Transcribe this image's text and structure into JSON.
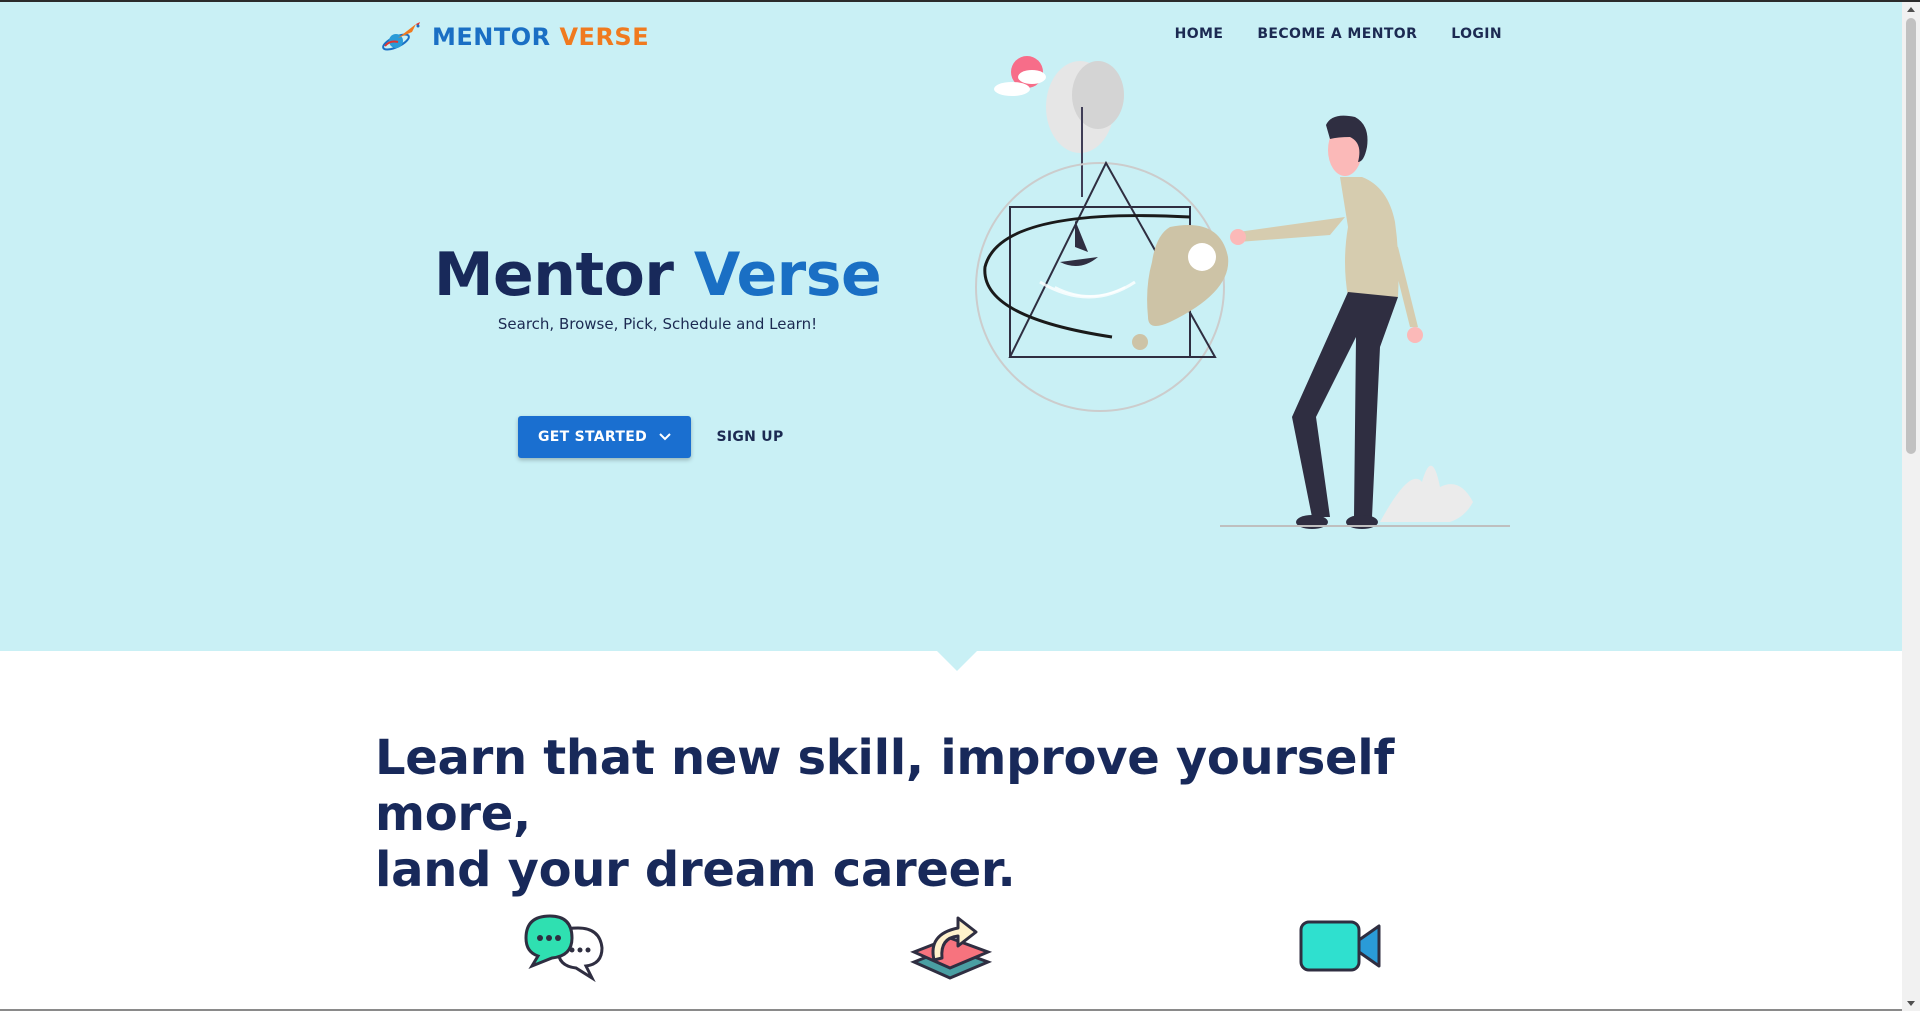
{
  "brand": {
    "word1": "MENTOR",
    "word2": "VERSE",
    "word1_color": "#1a6fc4",
    "word2_color": "#f07a1f"
  },
  "nav": {
    "items": [
      {
        "label": "HOME"
      },
      {
        "label": "BECOME A MENTOR"
      },
      {
        "label": "LOGIN"
      }
    ]
  },
  "hero": {
    "title_part1": "Mentor",
    "title_part2": "Verse",
    "subtitle": "Search, Browse, Pick, Schedule and Learn!",
    "primary_button": "GET STARTED",
    "secondary_button": "SIGN UP",
    "background": "#c9f0f5"
  },
  "section": {
    "headline_line1": "Learn that new skill, improve yourself more,",
    "headline_line2": "land your dream career."
  },
  "features": [
    {
      "icon": "chat-bubbles-icon"
    },
    {
      "icon": "share-layers-icon"
    },
    {
      "icon": "video-camera-icon"
    }
  ]
}
